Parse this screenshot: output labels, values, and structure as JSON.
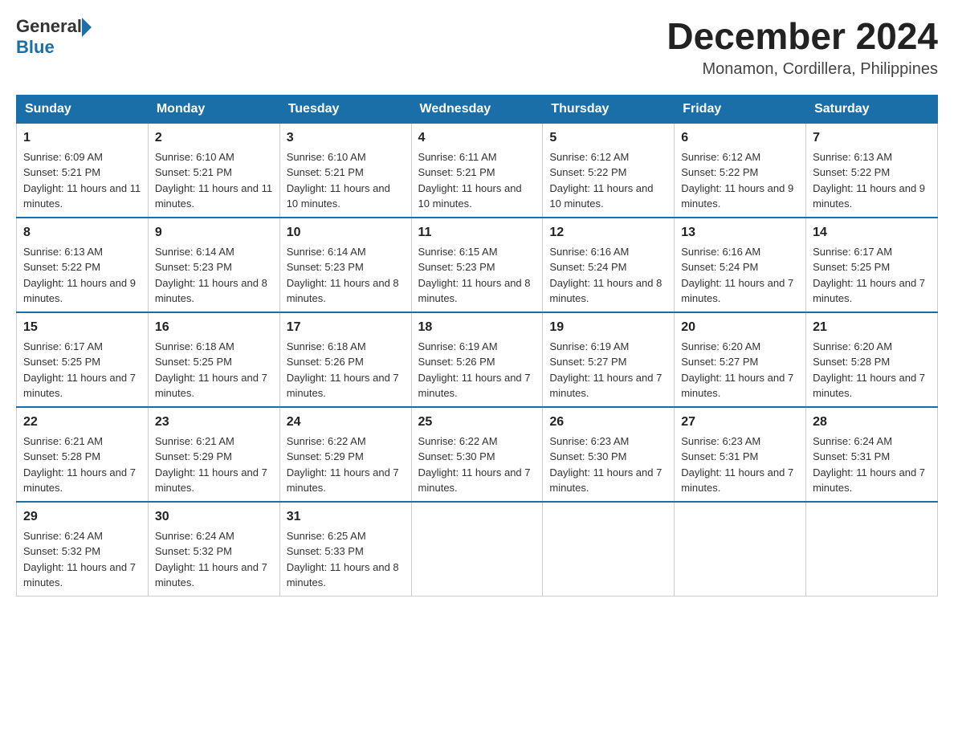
{
  "header": {
    "logo_general": "General",
    "logo_blue": "Blue",
    "month_title": "December 2024",
    "location": "Monamon, Cordillera, Philippines"
  },
  "days_of_week": [
    "Sunday",
    "Monday",
    "Tuesday",
    "Wednesday",
    "Thursday",
    "Friday",
    "Saturday"
  ],
  "weeks": [
    [
      {
        "day": "1",
        "sunrise": "6:09 AM",
        "sunset": "5:21 PM",
        "daylight": "11 hours and 11 minutes."
      },
      {
        "day": "2",
        "sunrise": "6:10 AM",
        "sunset": "5:21 PM",
        "daylight": "11 hours and 11 minutes."
      },
      {
        "day": "3",
        "sunrise": "6:10 AM",
        "sunset": "5:21 PM",
        "daylight": "11 hours and 10 minutes."
      },
      {
        "day": "4",
        "sunrise": "6:11 AM",
        "sunset": "5:21 PM",
        "daylight": "11 hours and 10 minutes."
      },
      {
        "day": "5",
        "sunrise": "6:12 AM",
        "sunset": "5:22 PM",
        "daylight": "11 hours and 10 minutes."
      },
      {
        "day": "6",
        "sunrise": "6:12 AM",
        "sunset": "5:22 PM",
        "daylight": "11 hours and 9 minutes."
      },
      {
        "day": "7",
        "sunrise": "6:13 AM",
        "sunset": "5:22 PM",
        "daylight": "11 hours and 9 minutes."
      }
    ],
    [
      {
        "day": "8",
        "sunrise": "6:13 AM",
        "sunset": "5:22 PM",
        "daylight": "11 hours and 9 minutes."
      },
      {
        "day": "9",
        "sunrise": "6:14 AM",
        "sunset": "5:23 PM",
        "daylight": "11 hours and 8 minutes."
      },
      {
        "day": "10",
        "sunrise": "6:14 AM",
        "sunset": "5:23 PM",
        "daylight": "11 hours and 8 minutes."
      },
      {
        "day": "11",
        "sunrise": "6:15 AM",
        "sunset": "5:23 PM",
        "daylight": "11 hours and 8 minutes."
      },
      {
        "day": "12",
        "sunrise": "6:16 AM",
        "sunset": "5:24 PM",
        "daylight": "11 hours and 8 minutes."
      },
      {
        "day": "13",
        "sunrise": "6:16 AM",
        "sunset": "5:24 PM",
        "daylight": "11 hours and 7 minutes."
      },
      {
        "day": "14",
        "sunrise": "6:17 AM",
        "sunset": "5:25 PM",
        "daylight": "11 hours and 7 minutes."
      }
    ],
    [
      {
        "day": "15",
        "sunrise": "6:17 AM",
        "sunset": "5:25 PM",
        "daylight": "11 hours and 7 minutes."
      },
      {
        "day": "16",
        "sunrise": "6:18 AM",
        "sunset": "5:25 PM",
        "daylight": "11 hours and 7 minutes."
      },
      {
        "day": "17",
        "sunrise": "6:18 AM",
        "sunset": "5:26 PM",
        "daylight": "11 hours and 7 minutes."
      },
      {
        "day": "18",
        "sunrise": "6:19 AM",
        "sunset": "5:26 PM",
        "daylight": "11 hours and 7 minutes."
      },
      {
        "day": "19",
        "sunrise": "6:19 AM",
        "sunset": "5:27 PM",
        "daylight": "11 hours and 7 minutes."
      },
      {
        "day": "20",
        "sunrise": "6:20 AM",
        "sunset": "5:27 PM",
        "daylight": "11 hours and 7 minutes."
      },
      {
        "day": "21",
        "sunrise": "6:20 AM",
        "sunset": "5:28 PM",
        "daylight": "11 hours and 7 minutes."
      }
    ],
    [
      {
        "day": "22",
        "sunrise": "6:21 AM",
        "sunset": "5:28 PM",
        "daylight": "11 hours and 7 minutes."
      },
      {
        "day": "23",
        "sunrise": "6:21 AM",
        "sunset": "5:29 PM",
        "daylight": "11 hours and 7 minutes."
      },
      {
        "day": "24",
        "sunrise": "6:22 AM",
        "sunset": "5:29 PM",
        "daylight": "11 hours and 7 minutes."
      },
      {
        "day": "25",
        "sunrise": "6:22 AM",
        "sunset": "5:30 PM",
        "daylight": "11 hours and 7 minutes."
      },
      {
        "day": "26",
        "sunrise": "6:23 AM",
        "sunset": "5:30 PM",
        "daylight": "11 hours and 7 minutes."
      },
      {
        "day": "27",
        "sunrise": "6:23 AM",
        "sunset": "5:31 PM",
        "daylight": "11 hours and 7 minutes."
      },
      {
        "day": "28",
        "sunrise": "6:24 AM",
        "sunset": "5:31 PM",
        "daylight": "11 hours and 7 minutes."
      }
    ],
    [
      {
        "day": "29",
        "sunrise": "6:24 AM",
        "sunset": "5:32 PM",
        "daylight": "11 hours and 7 minutes."
      },
      {
        "day": "30",
        "sunrise": "6:24 AM",
        "sunset": "5:32 PM",
        "daylight": "11 hours and 7 minutes."
      },
      {
        "day": "31",
        "sunrise": "6:25 AM",
        "sunset": "5:33 PM",
        "daylight": "11 hours and 8 minutes."
      },
      null,
      null,
      null,
      null
    ]
  ]
}
